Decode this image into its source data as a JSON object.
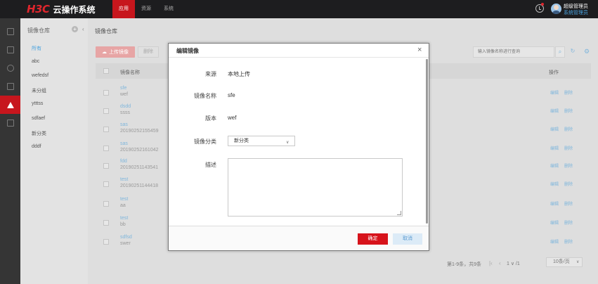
{
  "app": {
    "logo": "H3C",
    "title": "云操作系统",
    "nav": [
      {
        "label": "应用",
        "active": true
      },
      {
        "label": "资源",
        "active": false
      },
      {
        "label": "系统",
        "active": false
      }
    ],
    "user": {
      "name": "超级管理员",
      "role": "系统管理员"
    }
  },
  "sidebar": {
    "title": "镜像仓库",
    "add_icon": "+",
    "collapse_icon": "‹",
    "items": [
      {
        "label": "所有",
        "active": true
      },
      {
        "label": "abc",
        "active": false
      },
      {
        "label": "wefedsf",
        "active": false
      },
      {
        "label": "未分组",
        "active": false
      },
      {
        "label": "ytttss",
        "active": false
      },
      {
        "label": "sdfaef",
        "active": false
      },
      {
        "label": "新分类",
        "active": false
      },
      {
        "label": "dddf",
        "active": false
      }
    ]
  },
  "content": {
    "breadcrumb": "镜像仓库",
    "upload_label": "上传镜像",
    "delete_label": "删除",
    "search_placeholder": "输入镜像名称进行查询",
    "columns": {
      "name": "镜像名称",
      "ops": "操作"
    },
    "rows": [
      {
        "name": "sfe",
        "sub": "wef",
        "edit": "编辑",
        "del": "删除"
      },
      {
        "name": "dsdd",
        "sub": "ssss",
        "edit": "编辑",
        "del": "删除"
      },
      {
        "name": "sas",
        "sub": "20190252155459",
        "edit": "编辑",
        "del": "删除"
      },
      {
        "name": "sas",
        "sub": "20190252161042",
        "edit": "编辑",
        "del": "删除"
      },
      {
        "name": "fdd",
        "sub": "20190251143541",
        "edit": "编辑",
        "del": "删除"
      },
      {
        "name": "test",
        "sub": "20190251144418",
        "edit": "编辑",
        "del": "删除"
      },
      {
        "name": "test",
        "sub": "aa",
        "edit": "编辑",
        "del": "删除"
      },
      {
        "name": "test",
        "sub": "bb",
        "edit": "编辑",
        "del": "删除"
      },
      {
        "name": "sdfsd",
        "sub": "swer",
        "edit": "编辑",
        "del": "删除"
      }
    ],
    "pagination": {
      "info": "第1-9条，共9条",
      "first": "|‹",
      "prev": "‹",
      "page": "1 ∨ /1",
      "page_size": "10条/页"
    }
  },
  "modal": {
    "title": "编辑镜像",
    "close": "×",
    "fields": {
      "source_label": "来源",
      "source_value": "本地上传",
      "name_label": "镜像名称",
      "name_value": "sfe",
      "version_label": "版本",
      "version_value": "wef",
      "category_label": "镜像分类",
      "category_value": "新分类",
      "desc_label": "描述",
      "desc_value": ""
    },
    "ok_label": "确定",
    "cancel_label": "取消"
  }
}
